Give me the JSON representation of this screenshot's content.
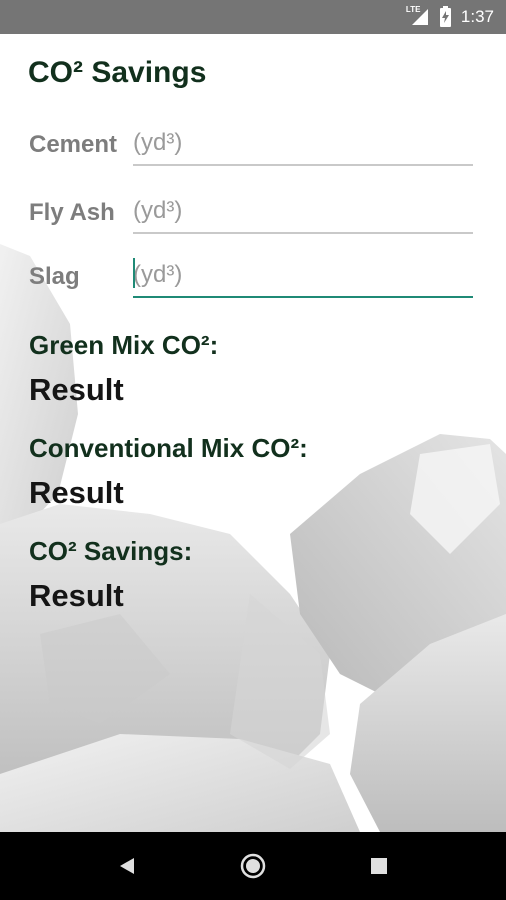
{
  "status_bar": {
    "network": "LTE",
    "time": "1:37",
    "icons": [
      "lte-signal-icon",
      "battery-charging-icon"
    ]
  },
  "page": {
    "title": "CO² Savings"
  },
  "inputs": [
    {
      "label": "Cement",
      "placeholder": "(yd³)",
      "value": ""
    },
    {
      "label": "Fly Ash",
      "placeholder": "(yd³)",
      "value": ""
    },
    {
      "label": "Slag",
      "placeholder": "(yd³)",
      "value": "",
      "focused": true
    }
  ],
  "results": [
    {
      "label": "Green Mix CO²:",
      "value": "Result"
    },
    {
      "label": "Conventional Mix CO²:",
      "value": "Result"
    },
    {
      "label": "CO² Savings:",
      "value": "Result"
    }
  ],
  "nav": {
    "icons": [
      "back-icon",
      "home-icon",
      "recents-icon"
    ]
  },
  "colors": {
    "title_green": "#12301d",
    "label_gray": "#7d7d7d",
    "focus_teal": "#1f8a76",
    "status_bar": "#757575",
    "nav_bar": "#000000"
  }
}
